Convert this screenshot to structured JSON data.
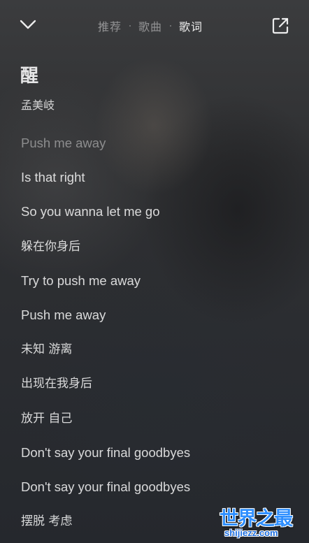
{
  "top_bar": {
    "tabs": [
      {
        "label": "推荐"
      },
      {
        "label": "歌曲"
      },
      {
        "label": "歌词"
      }
    ],
    "active_tab": "歌词",
    "left_icon": "chevron-down-icon",
    "right_icon": "share-external-icon"
  },
  "song": {
    "title": "醒",
    "artist": "孟美岐"
  },
  "lyrics": [
    {
      "text": "Push me away"
    },
    {
      "text": "Is that right"
    },
    {
      "text": "So you wanna let me go"
    },
    {
      "text": "躲在你身后"
    },
    {
      "text": "Try to push me away"
    },
    {
      "text": "Push me away"
    },
    {
      "text": "未知 游离"
    },
    {
      "text": "出现在我身后"
    },
    {
      "text": "放开 自己"
    },
    {
      "text": "Don't say your final goodbyes"
    },
    {
      "text": "Don't say your final goodbyes"
    },
    {
      "text": "摆脱 考虑"
    }
  ],
  "watermark": {
    "main": "世界之最",
    "sub": "shijiezz.com"
  },
  "colors": {
    "background": "#2e3033",
    "text_active": "#ffffff",
    "watermark": "#2f8fff"
  }
}
